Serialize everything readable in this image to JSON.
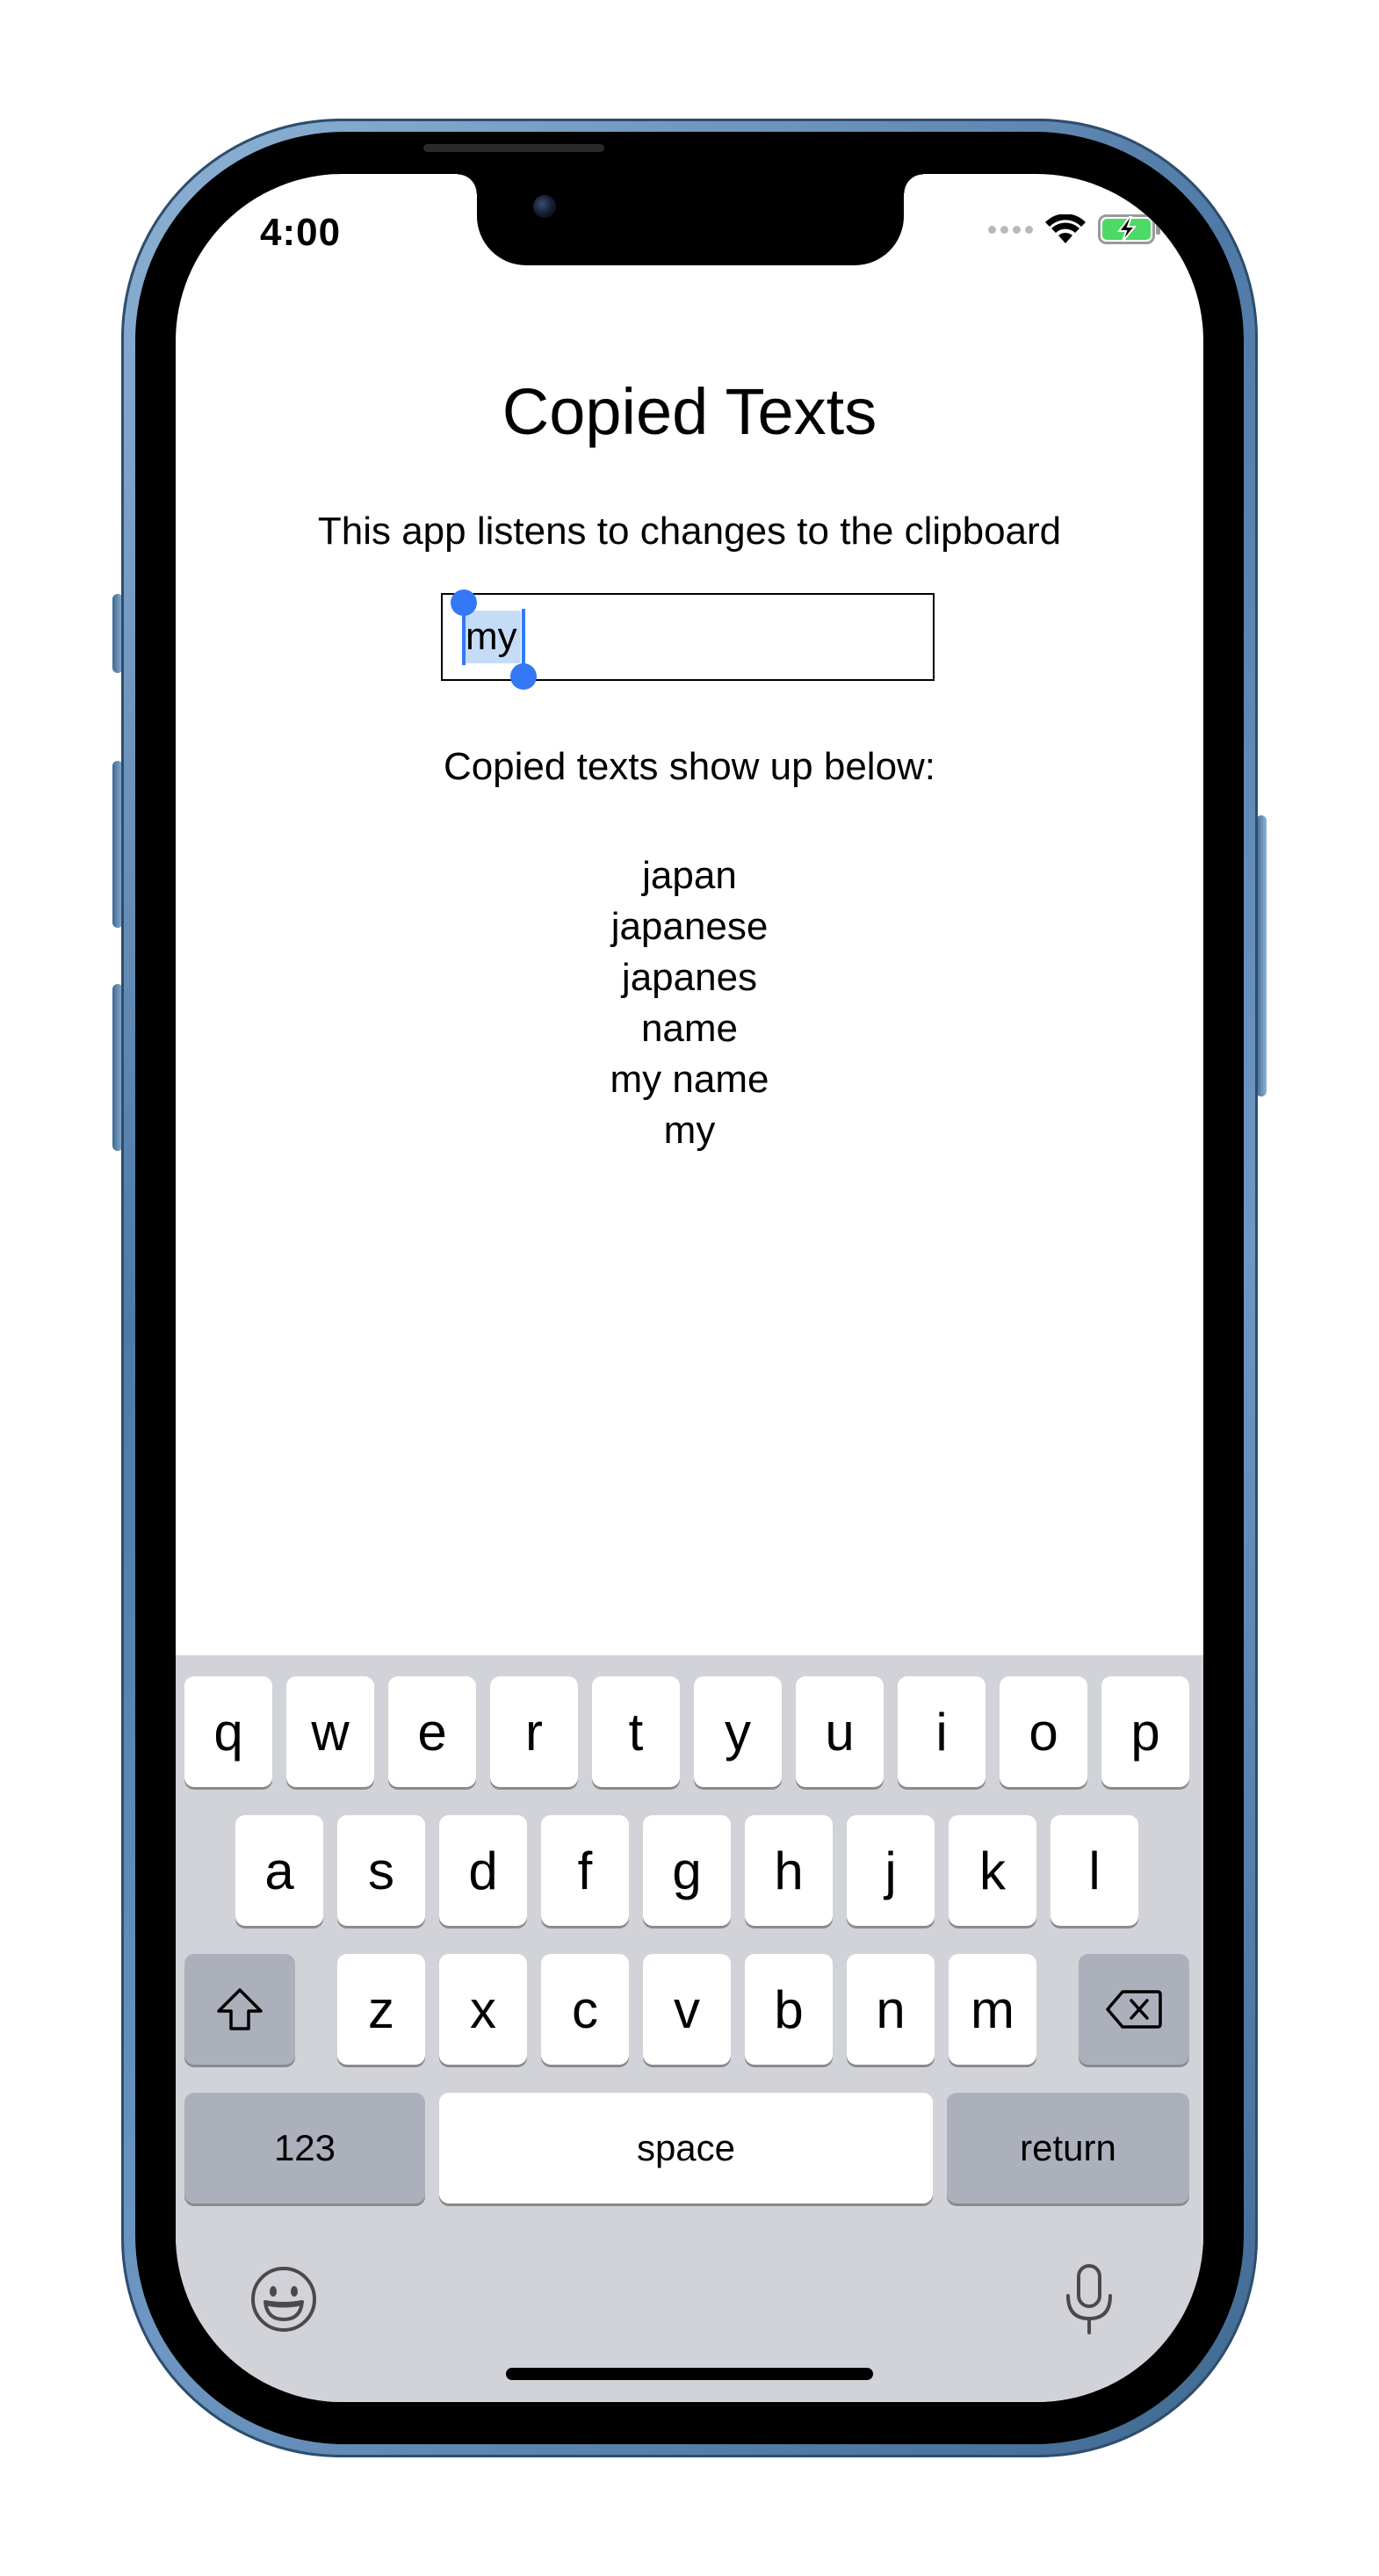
{
  "status_bar": {
    "time": "4:00",
    "wifi_icon": "wifi-icon",
    "battery_icon": "battery-charging-icon",
    "battery_color": "#4cd964"
  },
  "app": {
    "title": "Copied Texts",
    "subtitle": "This app listens to changes to the clipboard",
    "input": {
      "value": "my",
      "selection_color": "#c5dcf7",
      "handle_color": "#3478f6"
    },
    "list_label": "Copied texts show up below:",
    "copied_items": [
      "japan",
      "japanese",
      "japanes",
      "name",
      "my name",
      "my"
    ]
  },
  "keyboard": {
    "row1": [
      "q",
      "w",
      "e",
      "r",
      "t",
      "y",
      "u",
      "i",
      "o",
      "p"
    ],
    "row2": [
      "a",
      "s",
      "d",
      "f",
      "g",
      "h",
      "j",
      "k",
      "l"
    ],
    "row3": [
      "z",
      "x",
      "c",
      "v",
      "b",
      "n",
      "m"
    ],
    "numbers_label": "123",
    "space_label": "space",
    "return_label": "return",
    "shift_icon": "shift-icon",
    "delete_icon": "delete-icon",
    "emoji_icon": "emoji-icon",
    "mic_icon": "microphone-icon"
  }
}
